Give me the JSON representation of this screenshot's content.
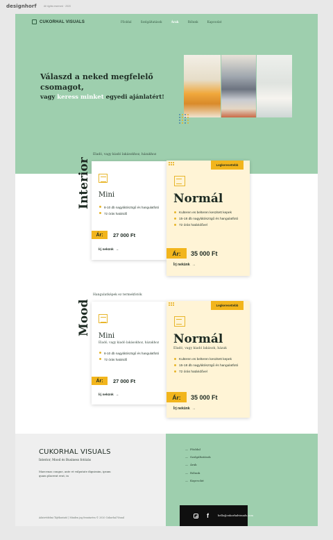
{
  "topbar": {
    "logo": "designhorf",
    "sub": "All rights reserved · 2020"
  },
  "nav": {
    "brand": "CUKORHAL VISUALS",
    "items": [
      "Főoldal",
      "Szolgáltatások",
      "Árak",
      "Rólunk",
      "Kapcsolat"
    ],
    "active_index": 2
  },
  "hero": {
    "line1": "Válaszd a neked megfelelő",
    "line2": "csomagot,",
    "line3_pre": "vagy ",
    "line3_highlight": "keress minket",
    "line3_post": " egyedi ajánlatért!",
    "photos": [
      "kitchen-breakfast-photo",
      "living-room-photo",
      "bright-room-photo"
    ]
  },
  "sections": [
    {
      "title": "Interior",
      "label": "Eladó, vagy kiadó lakásokhoz, házakhoz",
      "cards": [
        {
          "tier": "Mini",
          "desc": "",
          "features": [
            "8-10 db nagylátószögű és hangulatfotó",
            "72 órás határidő"
          ],
          "price_label": "Ár:",
          "price": "27 000 Ft",
          "cta": "Írj nekünk"
        },
        {
          "badge": "Legkeresettebb",
          "tier": "Normál",
          "desc": "",
          "features": [
            "Kulteren es belteren keszitett kepek",
            "15-18 db nagylátószögű és hangulatfotó",
            "72 órás határidővel"
          ],
          "price_label": "Ár:",
          "price": "35 000 Ft",
          "cta": "Írj nekünk"
        }
      ]
    },
    {
      "title": "Mood",
      "label": "Hangulatképek ez termekfotók",
      "cards": [
        {
          "tier": "Mini",
          "desc": "Eladó, vagy kiadó lakásokhoz, házakhoz",
          "features": [
            "8-10 db nagylátószögű és hangulatfotó",
            "72 órás határidő"
          ],
          "price_label": "Ár:",
          "price": "27 000 Ft",
          "cta": "Írj nekünk"
        },
        {
          "badge": "Legkeresettebb",
          "tier": "Normál",
          "desc": "Eladó, vagy kiadó lakások, házak",
          "features": [
            "Kulteren es belteren keszitett kepek",
            "15-18 db nagylátószögű és hangulatfotó",
            "72 órás határidővel"
          ],
          "price_label": "Ár:",
          "price": "35 000 Ft",
          "cta": "Írj nekünk"
        }
      ]
    }
  ],
  "footer": {
    "brand": "CUKORHAL VISUALS",
    "tagline": "Interior, Mood és Business fotózás",
    "text": "Maecenas congue, ante et vulputate dignissim, ipsum quam placerat erat, in",
    "copyright": "Adatvédelmi Tájékoztató | Minden jog fenntartva © 2020 Cukorhal Visual",
    "menu": [
      "Főoldal",
      "Szolgáltatások",
      "Árak",
      "Rólunk",
      "Kapcsolat"
    ],
    "email": "hello@cukorhalvisuals.com"
  },
  "colors": {
    "mint": "#9ecfae",
    "yellow": "#f2b51c",
    "cream": "#fff4d6",
    "dark": "#1d2a22"
  }
}
